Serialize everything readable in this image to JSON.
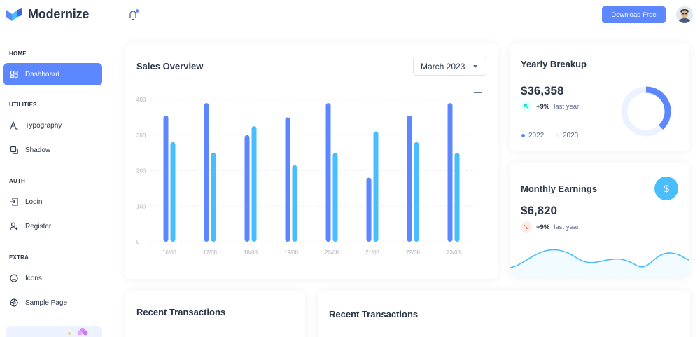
{
  "app": {
    "name": "Modernize"
  },
  "sidebar": {
    "sections": [
      {
        "caption": "HOME",
        "items": [
          {
            "label": "Dashboard",
            "icon": "dashboard-icon",
            "active": true
          }
        ]
      },
      {
        "caption": "UTILITIES",
        "items": [
          {
            "label": "Typography",
            "icon": "typography-icon"
          },
          {
            "label": "Shadow",
            "icon": "shadow-icon"
          }
        ]
      },
      {
        "caption": "AUTH",
        "items": [
          {
            "label": "Login",
            "icon": "login-icon"
          },
          {
            "label": "Register",
            "icon": "register-icon"
          }
        ]
      },
      {
        "caption": "EXTRA",
        "items": [
          {
            "label": "Icons",
            "icon": "mood-icon"
          },
          {
            "label": "Sample Page",
            "icon": "aperture-icon"
          }
        ]
      }
    ]
  },
  "header": {
    "download_label": "Download Free"
  },
  "sales": {
    "title": "Sales Overview",
    "month_select": "March 2023"
  },
  "yearly": {
    "title": "Yearly Breakup",
    "value": "$36,358",
    "change": "+9%",
    "change_label": "last year",
    "legend": [
      "2022",
      "2023"
    ],
    "donut_fraction": 0.38
  },
  "monthly": {
    "title": "Monthly Earnings",
    "value": "$6,820",
    "change": "+9%",
    "change_label": "last year"
  },
  "recent_left": {
    "title": "Recent Transactions"
  },
  "recent_right": {
    "title": "Recent Transactions"
  },
  "colors": {
    "primary": "#5d87ff",
    "secondary": "#49beff",
    "primary_light": "#ecf2ff",
    "success_light": "#e6fffa",
    "success": "#13deb9",
    "error_light": "#fdede8",
    "error": "#fa896b"
  },
  "chart_data": {
    "type": "bar",
    "categories": [
      "16/08",
      "17/08",
      "18/08",
      "19/08",
      "20/08",
      "21/08",
      "22/08",
      "23/08"
    ],
    "series": [
      {
        "values": [
          355,
          390,
          300,
          350,
          390,
          180,
          355,
          390
        ]
      },
      {
        "values": [
          280,
          250,
          325,
          215,
          250,
          310,
          280,
          250
        ]
      }
    ],
    "yticks": [
      0,
      100,
      200,
      300,
      400
    ],
    "ylim": [
      0,
      400
    ],
    "grid": true
  }
}
